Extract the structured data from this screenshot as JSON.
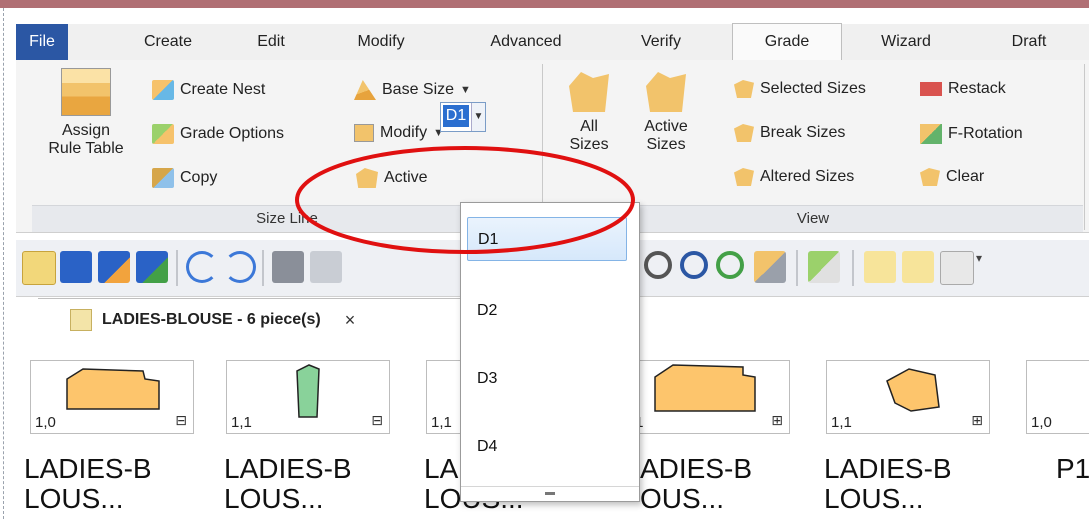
{
  "menu": {
    "tabs": [
      "File",
      "Create",
      "Edit",
      "Modify",
      "Advanced",
      "Verify",
      "Grade",
      "Wizard",
      "Draft"
    ],
    "active_tab": "Grade"
  },
  "ribbon": {
    "size_line": {
      "assign_rule_table_line1": "Assign",
      "assign_rule_table_line2": "Rule Table",
      "create_nest": "Create Nest",
      "grade_options": "Grade Options",
      "copy": "Copy",
      "base_size": "Base Size",
      "modify": "Modify",
      "active": "Active",
      "active_value": "D1",
      "group_label": "Size Line"
    },
    "view": {
      "all_sizes_line1": "All",
      "all_sizes_line2": "Sizes",
      "active_sizes_line1": "Active",
      "active_sizes_line2": "Sizes",
      "selected_sizes": "Selected Sizes",
      "break_sizes": "Break Sizes",
      "altered_sizes": "Altered Sizes",
      "restack": "Restack",
      "f_rotation": "F-Rotation",
      "clear": "Clear",
      "group_label": "View"
    }
  },
  "document_tab": {
    "title": "LADIES-BLOUSE  -  6 piece(s)",
    "close": "×"
  },
  "pieces": [
    {
      "num": "1,0",
      "name_line1": "LADIES-B",
      "name_line2": "LOUS...",
      "color": "#fdc56c"
    },
    {
      "num": "1,1",
      "name_line1": "LADIES-B",
      "name_line2": "LOUS...",
      "color": "#89d29a"
    },
    {
      "num": "1,1",
      "name_line1": "LA",
      "name_line2": "LOUS...",
      "color": "#fdc56c"
    },
    {
      "num": ",1",
      "name_line1": "ADIES-B",
      "name_line2": "OUS...",
      "color": "#fdc56c"
    },
    {
      "num": "1,1",
      "name_line1": "LADIES-B",
      "name_line2": "LOUS...",
      "color": "#fdc56c"
    },
    {
      "num": "1,0",
      "name_line1": "P1",
      "name_line2": "",
      "color": "#fdc56c"
    }
  ],
  "dropdown": {
    "options": [
      "D1",
      "D2",
      "D3",
      "D4"
    ],
    "selected": "D1"
  },
  "colors": {
    "file_tab": "#2b57a4",
    "annotation_circle": "#e01010",
    "piece_fill": "#fdc56c"
  }
}
